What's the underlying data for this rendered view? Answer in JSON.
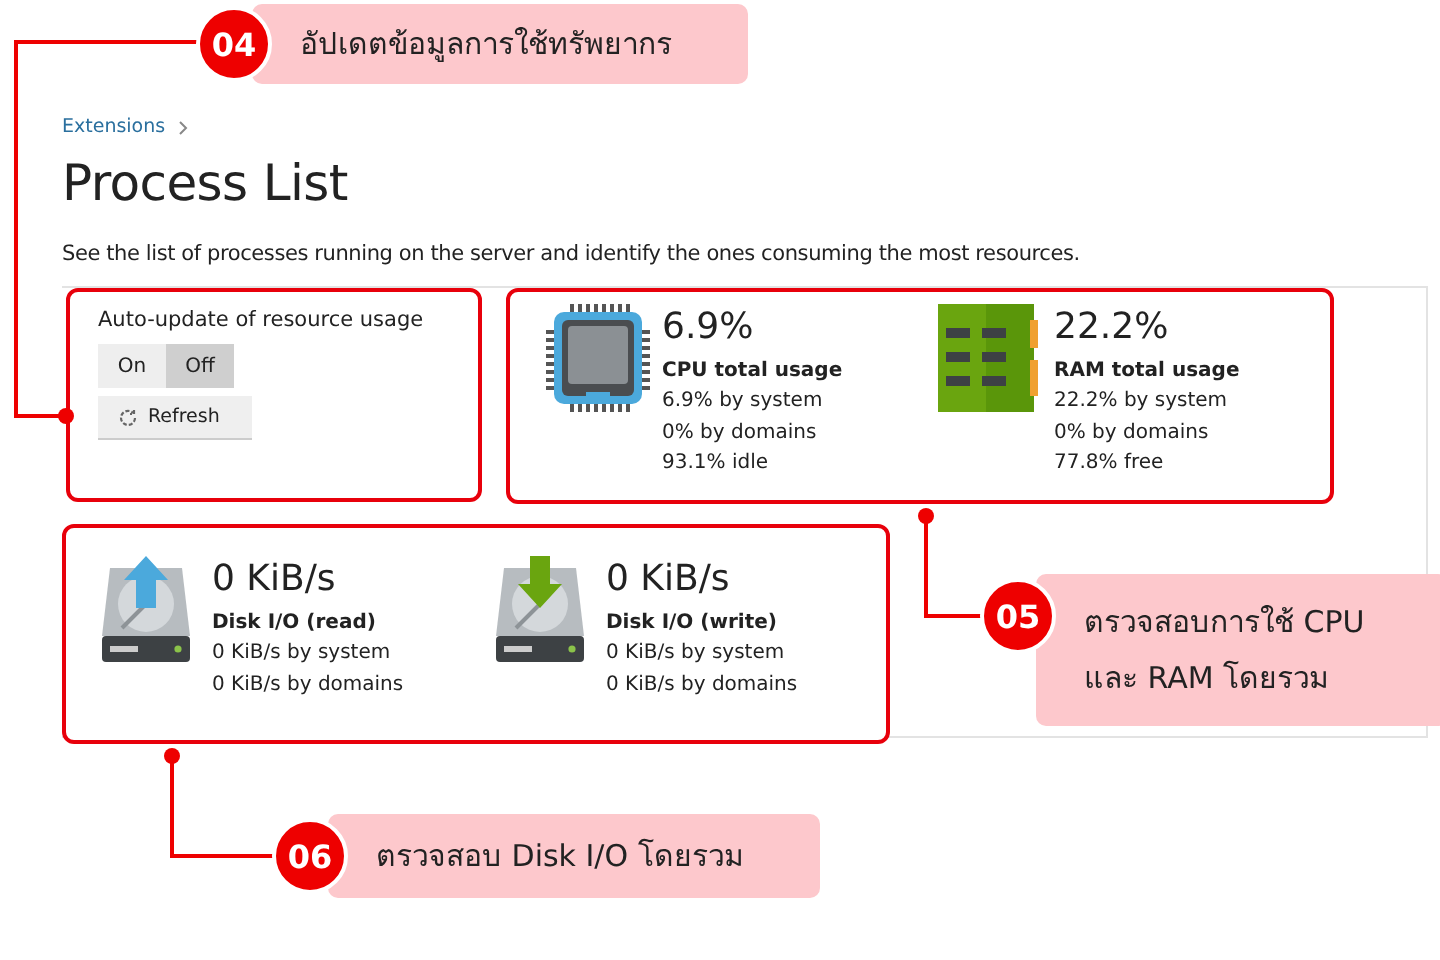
{
  "breadcrumb": {
    "label": "Extensions"
  },
  "title": "Process List",
  "description": "See the list of processes running on the server and identify the ones consuming the most resources.",
  "auto_update": {
    "label": "Auto-update of resource usage",
    "options": [
      {
        "label": "On",
        "selected": false
      },
      {
        "label": "Off",
        "selected": true
      }
    ],
    "refresh": "Refresh"
  },
  "metrics": [
    {
      "kind": "cpu",
      "value": "6.9%",
      "label": "CPU total usage",
      "details": [
        "6.9% by system",
        "0% by domains",
        "93.1% idle"
      ]
    },
    {
      "kind": "ram",
      "value": "22.2%",
      "label": "RAM total usage",
      "details": [
        "22.2% by system",
        "0% by domains",
        "77.8% free"
      ]
    }
  ],
  "disk": [
    {
      "kind": "read",
      "value": "0 KiB/s",
      "label": "Disk I/O (read)",
      "details": [
        "0 KiB/s by system",
        "0 KiB/s by domains"
      ]
    },
    {
      "kind": "write",
      "value": "0 KiB/s",
      "label": "Disk I/O (write)",
      "details": [
        "0 KiB/s by system",
        "0 KiB/s by domains"
      ]
    }
  ],
  "callouts": [
    {
      "number": "04",
      "lines": [
        "อัปเดตข้อมูลการใช้ทรัพยากร"
      ]
    },
    {
      "number": "05",
      "lines": [
        "ตรวจสอบการใช้ CPU",
        "และ RAM โดยรวม"
      ]
    },
    {
      "number": "06",
      "lines": [
        "ตรวจสอบ Disk I/O โดยรวม"
      ]
    }
  ]
}
